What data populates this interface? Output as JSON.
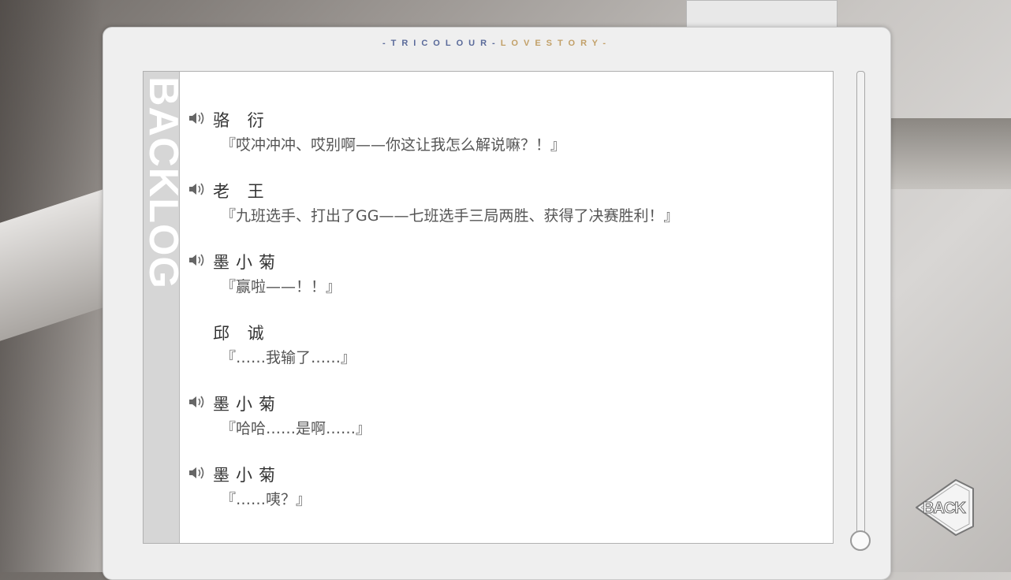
{
  "brand": {
    "part1": "-TRICOLOUR-",
    "part2": "LOVESTORY-"
  },
  "side_title": "BACKLOG",
  "entries": [
    {
      "name": "骆 衍",
      "line": "『哎冲冲冲、哎别啊——你这让我怎么解说嘛？！』",
      "voice": true
    },
    {
      "name": "老 王",
      "line": "『九班选手、打出了GG——七班选手三局两胜、获得了决赛胜利！』",
      "voice": true
    },
    {
      "name": "墨小菊",
      "line": "『赢啦——！！』",
      "voice": true
    },
    {
      "name": "邱 诚",
      "line": "『……我输了……』",
      "voice": false
    },
    {
      "name": "墨小菊",
      "line": "『哈哈……是啊……』",
      "voice": true
    },
    {
      "name": "墨小菊",
      "line": "『……咦？』",
      "voice": true
    }
  ],
  "back_button": {
    "label": "BACK",
    "icon": "back-arrow-icon"
  },
  "colors": {
    "brand_blue": "#5a6a9a",
    "brand_gold": "#c2a068",
    "panel": "#ffffff"
  }
}
